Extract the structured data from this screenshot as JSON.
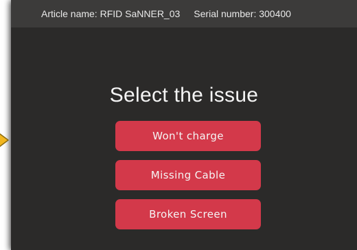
{
  "header": {
    "article_label": "Article name: RFID SaNNER_03",
    "serial_label": "Serial number: 300400"
  },
  "main": {
    "title": "Select the issue",
    "issues": [
      {
        "label": "Won't charge"
      },
      {
        "label": "Missing Cable"
      },
      {
        "label": "Broken Screen"
      }
    ]
  },
  "colors": {
    "background": "#2b2a29",
    "header": "#3c3b3a",
    "button": "#d3394a",
    "pointer": "#f2b61f"
  },
  "icons": {
    "pointer_marker": "arrow-pointer-icon"
  }
}
